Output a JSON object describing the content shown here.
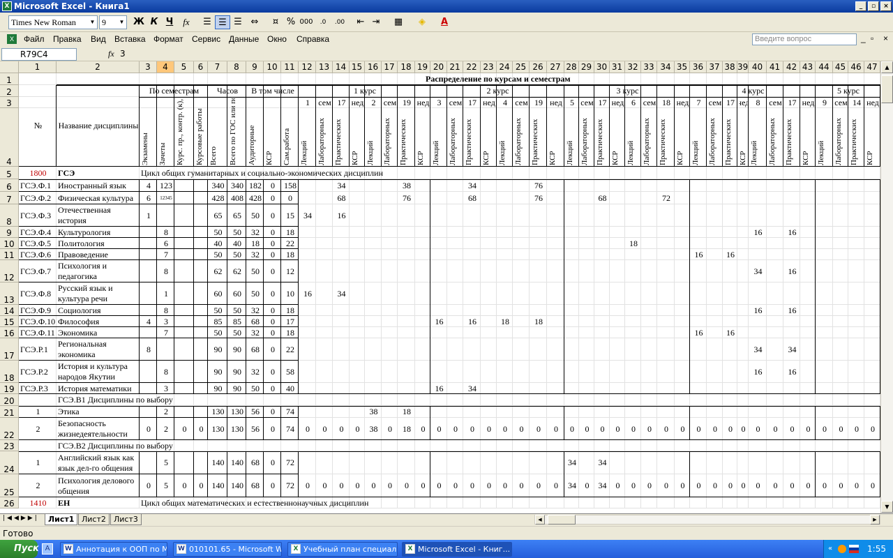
{
  "app": {
    "title": "Microsoft Excel - Книга1",
    "win_min": "_",
    "win_restore": "▫",
    "win_close": "×"
  },
  "toolbar": {
    "font_name": "Times New Roman",
    "font_size": "9",
    "bold": "Ж",
    "italic": "К",
    "underline": "Ч",
    "percent": "%",
    "thousands": "000",
    "fx_btn": "fx"
  },
  "menu": {
    "items": [
      "Файл",
      "Правка",
      "Вид",
      "Вставка",
      "Формат",
      "Сервис",
      "Данные",
      "Окно",
      "Справка"
    ],
    "ask_placeholder": "Введите вопрос"
  },
  "formula_bar": {
    "name_box": "R79C4",
    "fx": "fx",
    "value": "3"
  },
  "sheet": {
    "col_headers": [
      "1",
      "2",
      "3",
      "4",
      "5",
      "6",
      "7",
      "8",
      "9",
      "10",
      "11",
      "12",
      "13",
      "14",
      "15",
      "16",
      "17",
      "18",
      "19",
      "20",
      "21",
      "22",
      "23",
      "24",
      "25",
      "26",
      "27",
      "28",
      "29",
      "30",
      "31",
      "32",
      "33",
      "34",
      "35",
      "36",
      "37",
      "38",
      "39",
      "40",
      "41",
      "42",
      "43",
      "44",
      "45",
      "46",
      "47"
    ],
    "row_headers": [
      "1",
      "2",
      "3",
      "4",
      "5",
      "6",
      "7",
      "8",
      "9",
      "10",
      "11",
      "12",
      "13",
      "14",
      "15",
      "16",
      "17",
      "18",
      "19",
      "20",
      "21",
      "22",
      "23",
      "24",
      "25",
      "26"
    ],
    "header": {
      "distribution": "Распределение по курсам и семестрам",
      "num": "№",
      "discipline": "Название дисциплины",
      "by_semesters": "По семестрам",
      "hours": "Часов",
      "including": "В том числе",
      "course1": "1 курс",
      "course2": "2 курс",
      "course3": "3 курс",
      "course4": "4 курс",
      "course5": "5 курс",
      "row3": [
        "1",
        "сем",
        "17",
        "нед",
        "2",
        "сем",
        "19",
        "нед",
        "3",
        "сем",
        "17",
        "нед",
        "4",
        "сем",
        "19",
        "нед",
        "5",
        "сем",
        "17",
        "нед",
        "6",
        "сем",
        "18",
        "нед",
        "7",
        "сем",
        "17",
        "нед",
        "8",
        "сем",
        "17",
        "нед",
        "9",
        "сем",
        "14",
        "нед"
      ],
      "vert_left": [
        "Экзамены",
        "Зачеты",
        "Курс. пр., контр. (к), рефер. (р)",
        "Курсовые работы",
        "Всего",
        "Всего по ГОС или по ЗЕТ",
        "Аудиторные",
        "КСР",
        "Сам.работа"
      ],
      "vert_sem": [
        "Лекций",
        "Лабораторных",
        "Практических",
        "КСР"
      ]
    },
    "rows": [
      {
        "r": 5,
        "c1": "1800",
        "c2": "ГСЭ",
        "note": "Цикл общих гуманитарных и социально-экономических дисциплин"
      },
      {
        "r": 6,
        "c1": "ГСЭ.Ф.1",
        "c2": "Иностранный язык",
        "v": {
          "3": "4",
          "4": "123",
          "7": "340",
          "8": "340",
          "9": "182",
          "10": "0",
          "11": "158",
          "14": "34",
          "18": "38",
          "22": "34",
          "26": "76"
        }
      },
      {
        "r": 7,
        "c1": "ГСЭ.Ф.2",
        "c2": "Физическая культура",
        "v": {
          "3": "6",
          "4": "12345",
          "7": "428",
          "8": "408",
          "9": "428",
          "10": "0",
          "11": "0",
          "14": "68",
          "18": "76",
          "22": "68",
          "26": "76",
          "30": "68",
          "34": "72"
        }
      },
      {
        "r": 8,
        "c1": "ГСЭ.Ф.3",
        "c2": "Отечественная история",
        "v": {
          "3": "1",
          "7": "65",
          "8": "65",
          "9": "50",
          "10": "0",
          "11": "15",
          "12": "34",
          "14": "16"
        }
      },
      {
        "r": 9,
        "c1": "ГСЭ.Ф.4",
        "c2": "Культурология",
        "v": {
          "4": "8",
          "7": "50",
          "8": "50",
          "9": "32",
          "10": "0",
          "11": "18",
          "40": "16",
          "42": "16"
        }
      },
      {
        "r": 10,
        "c1": "ГСЭ.Ф.5",
        "c2": "Политология",
        "v": {
          "4": "6",
          "7": "40",
          "8": "40",
          "9": "18",
          "10": "0",
          "11": "22",
          "32": "18"
        }
      },
      {
        "r": 11,
        "c1": "ГСЭ.Ф.6",
        "c2": "Правоведение",
        "v": {
          "4": "7",
          "7": "50",
          "8": "50",
          "9": "32",
          "10": "0",
          "11": "18",
          "36": "16",
          "38": "16"
        }
      },
      {
        "r": 12,
        "c1": "ГСЭ.Ф.7",
        "c2": "Психология и педагогика",
        "v": {
          "4": "8",
          "7": "62",
          "8": "62",
          "9": "50",
          "10": "0",
          "11": "12",
          "40": "34",
          "42": "16"
        }
      },
      {
        "r": 13,
        "c1": "ГСЭ.Ф.8",
        "c2": "Русский язык и культура речи",
        "v": {
          "4": "1",
          "7": "60",
          "8": "60",
          "9": "50",
          "10": "0",
          "11": "10",
          "12": "16",
          "14": "34"
        }
      },
      {
        "r": 14,
        "c1": "ГСЭ.Ф.9",
        "c2": "Социология",
        "v": {
          "4": "8",
          "7": "50",
          "8": "50",
          "9": "32",
          "10": "0",
          "11": "18",
          "40": "16",
          "42": "16"
        }
      },
      {
        "r": 15,
        "c1": "ГСЭ.Ф.10",
        "c2": "Философия",
        "v": {
          "3": "4",
          "4": "3",
          "7": "85",
          "8": "85",
          "9": "68",
          "10": "0",
          "11": "17",
          "20": "16",
          "22": "16",
          "24": "18",
          "26": "18"
        }
      },
      {
        "r": 16,
        "c1": "ГСЭ.Ф.11",
        "c2": "Экономика",
        "v": {
          "4": "7",
          "7": "50",
          "8": "50",
          "9": "32",
          "10": "0",
          "11": "18",
          "36": "16",
          "38": "16"
        }
      },
      {
        "r": 17,
        "c1": "ГСЭ.Р.1",
        "c2": "Региональная экономика",
        "v": {
          "3": "8",
          "7": "90",
          "8": "90",
          "9": "68",
          "10": "0",
          "11": "22",
          "40": "34",
          "42": "34"
        }
      },
      {
        "r": 18,
        "c1": "ГСЭ.Р.2",
        "c2": "История и культура народов Якутии",
        "v": {
          "4": "8",
          "7": "90",
          "8": "90",
          "9": "32",
          "10": "0",
          "11": "58",
          "40": "16",
          "42": "16"
        }
      },
      {
        "r": 19,
        "c1": "ГСЭ.Р.3",
        "c2": "История математики",
        "v": {
          "4": "3",
          "7": "90",
          "8": "90",
          "9": "50",
          "10": "0",
          "11": "40",
          "20": "16",
          "22": "34"
        }
      },
      {
        "r": 20,
        "c1": "",
        "c2": "ГСЭ.В1 Дисциплины по выбору"
      },
      {
        "r": 21,
        "c1": "1",
        "c2": "Этика",
        "v": {
          "4": "2",
          "7": "130",
          "8": "130",
          "9": "56",
          "10": "0",
          "11": "74",
          "16": "38",
          "18": "18"
        }
      },
      {
        "r": 22,
        "c1": "2",
        "c2": "Безопасность жизнедеятельности",
        "v": {
          "3": "0",
          "4": "2",
          "5": "0",
          "6": "0",
          "7": "130",
          "8": "130",
          "9": "56",
          "10": "0",
          "11": "74",
          "12": "0",
          "13": "0",
          "14": "0",
          "15": "0",
          "16": "38",
          "17": "0",
          "18": "18",
          "19": "0",
          "20": "0",
          "21": "0",
          "22": "0",
          "23": "0",
          "24": "0",
          "25": "0",
          "26": "0",
          "27": "0",
          "28": "0",
          "29": "0",
          "30": "0",
          "31": "0",
          "32": "0",
          "33": "0",
          "34": "0",
          "35": "0",
          "36": "0",
          "37": "0",
          "38": "0",
          "39": "0",
          "40": "0",
          "41": "0",
          "42": "0",
          "43": "0",
          "44": "0",
          "45": "0",
          "46": "0",
          "47": "0"
        }
      },
      {
        "r": 23,
        "c1": "",
        "c2": "ГСЭ.В2 Дисциплины по выбору"
      },
      {
        "r": 24,
        "c1": "1",
        "c2": "Английский язык как язык дел-го общения",
        "v": {
          "4": "5",
          "7": "140",
          "8": "140",
          "9": "68",
          "10": "0",
          "11": "72",
          "28": "34",
          "30": "34"
        }
      },
      {
        "r": 25,
        "c1": "2",
        "c2": "Психология делового общения",
        "v": {
          "3": "0",
          "4": "5",
          "5": "0",
          "6": "0",
          "7": "140",
          "8": "140",
          "9": "68",
          "10": "0",
          "11": "72",
          "12": "0",
          "13": "0",
          "14": "0",
          "15": "0",
          "16": "0",
          "17": "0",
          "18": "0",
          "19": "0",
          "20": "0",
          "21": "0",
          "22": "0",
          "23": "0",
          "24": "0",
          "25": "0",
          "26": "0",
          "27": "0",
          "28": "34",
          "29": "0",
          "30": "34",
          "31": "0",
          "32": "0",
          "33": "0",
          "34": "0",
          "35": "0",
          "36": "0",
          "37": "0",
          "38": "0",
          "39": "0",
          "40": "0",
          "41": "0",
          "42": "0",
          "43": "0",
          "44": "0",
          "45": "0",
          "46": "0",
          "47": "0"
        }
      },
      {
        "r": 26,
        "c1": "1410",
        "c2": "ЕН",
        "note": "Цикл общих математических и естественнонаучных дисциплин"
      }
    ],
    "tabs": [
      "Лист1",
      "Лист2",
      "Лист3"
    ]
  },
  "status": {
    "text": "Готово"
  },
  "taskbar": {
    "start": "Пуск",
    "tasks": [
      "Аннотация к ООП по М...",
      "010101.65 - Microsoft W...",
      "Учебный план специал...",
      "Microsoft Excel - Книг..."
    ],
    "clock": "1:55"
  }
}
